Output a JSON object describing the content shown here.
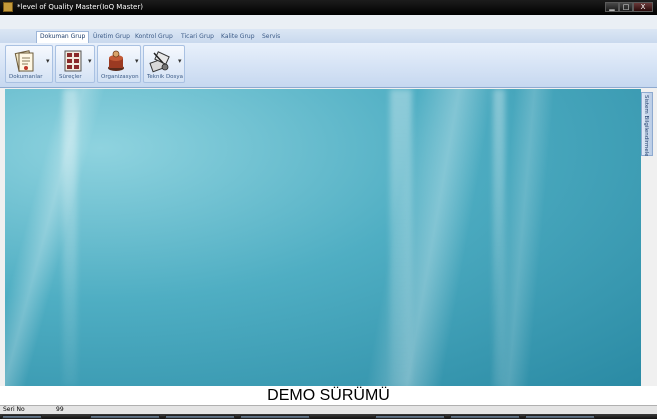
{
  "window": {
    "title": "*level of Quality Master(IoQ Master)",
    "minimize_glyph": "▁",
    "maximize_glyph": "□",
    "close_glyph": "X"
  },
  "ribbon_tabs": [
    {
      "label": "Dokuman Grup"
    },
    {
      "label": "Üretim Grup"
    },
    {
      "label": "Kontrol Grup"
    },
    {
      "label": "Ticari Grup"
    },
    {
      "label": "Kalite Grup"
    },
    {
      "label": "Servis"
    }
  ],
  "ribbon_groups": [
    {
      "label": "Dokumanlar",
      "icon": "documents-icon"
    },
    {
      "label": "Süreçler",
      "icon": "processes-icon"
    },
    {
      "label": "Organizasyon",
      "icon": "organization-icon"
    },
    {
      "label": "Teknik Dosya",
      "icon": "technical-file-icon"
    }
  ],
  "side_panel": {
    "label": "Sistem Bilgilendirmeleri"
  },
  "demo": {
    "text": "DEMO SÜRÜMÜ"
  },
  "status": {
    "label": "Seri No",
    "value": "99"
  },
  "colors": {
    "accent": "#3b5a86",
    "background": "#4faec3"
  }
}
